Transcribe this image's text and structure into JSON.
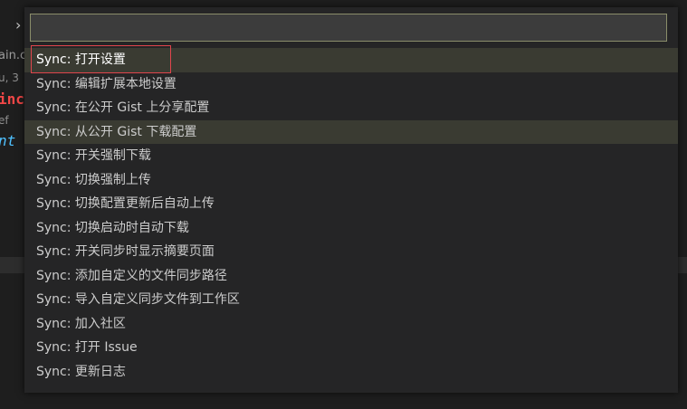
{
  "background": {
    "chevron": "›",
    "fragments": {
      "file": "ain.c",
      "line": "u, 3",
      "keyword": "inc",
      "ref": "ef",
      "ident": "nt"
    }
  },
  "quick_pick": {
    "input_value": "",
    "items": [
      {
        "label": "Sync: 打开设置",
        "state": "focused"
      },
      {
        "label": "Sync: 编辑扩展本地设置"
      },
      {
        "label": "Sync: 在公开 Gist 上分享配置"
      },
      {
        "label": "Sync: 从公开 Gist 下载配置",
        "state": "hovered"
      },
      {
        "label": "Sync: 开关强制下载"
      },
      {
        "label": "Sync: 切换强制上传"
      },
      {
        "label": "Sync: 切换配置更新后自动上传"
      },
      {
        "label": "Sync: 切换启动时自动下载"
      },
      {
        "label": "Sync: 开关同步时显示摘要页面"
      },
      {
        "label": "Sync: 添加自定义的文件同步路径"
      },
      {
        "label": "Sync: 导入自定义同步文件到工作区"
      },
      {
        "label": "Sync: 加入社区"
      },
      {
        "label": "Sync: 打开 Issue"
      },
      {
        "label": "Sync: 更新日志"
      }
    ]
  },
  "colors": {
    "focus_outline": "#e0454c",
    "selected_bg": "#3a3b32",
    "input_border": "#8a8d6a"
  }
}
